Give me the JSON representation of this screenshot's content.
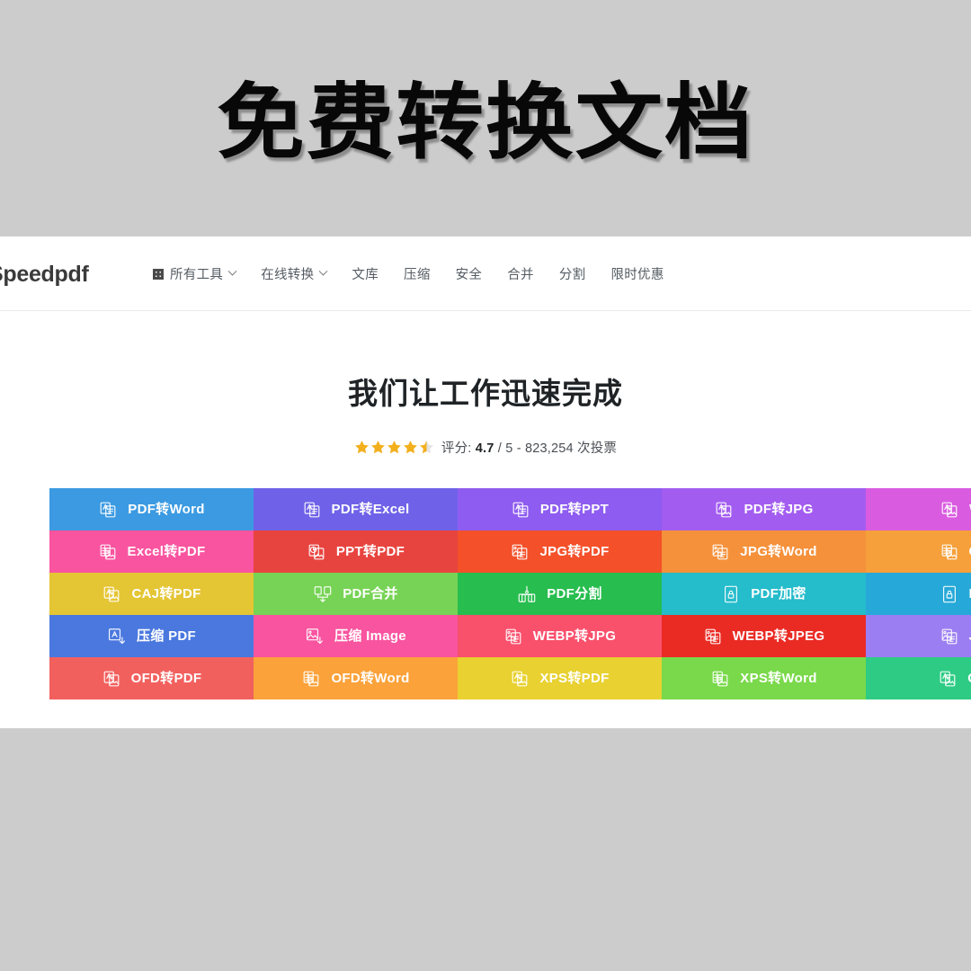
{
  "banner": {
    "title": "免费转换文档"
  },
  "navbar": {
    "brand": "Speedpdf",
    "items": [
      {
        "label": "所有工具",
        "icon": "grid-icon",
        "caret": true
      },
      {
        "label": "在线转换",
        "icon": null,
        "caret": true
      },
      {
        "label": "文库",
        "icon": null,
        "caret": false
      },
      {
        "label": "压缩",
        "icon": null,
        "caret": false
      },
      {
        "label": "安全",
        "icon": null,
        "caret": false
      },
      {
        "label": "合并",
        "icon": null,
        "caret": false
      },
      {
        "label": "分割",
        "icon": null,
        "caret": false
      },
      {
        "label": "限时优惠",
        "icon": null,
        "caret": false
      }
    ]
  },
  "hero": {
    "title": "我们让工作迅速完成",
    "rating": {
      "stars_filled": 4,
      "stars_half": 1,
      "stars_total": 5,
      "star_color": "#f2b01e",
      "prefix": "评分: ",
      "score": "4.7",
      "suffix": " / 5 - 823,254 次投票"
    }
  },
  "tools": {
    "columns": 5,
    "rows": 5,
    "tiles": [
      {
        "label": "PDF转Word",
        "color": "#3b9ae1",
        "icon": "doc-translate-icon"
      },
      {
        "label": "PDF转Excel",
        "color": "#6f62e8",
        "icon": "doc-translate-icon"
      },
      {
        "label": "PDF转PPT",
        "color": "#8e5cf0",
        "icon": "doc-translate-icon"
      },
      {
        "label": "PDF转JPG",
        "color": "#a35cf0",
        "icon": "doc-image-icon"
      },
      {
        "label": "Wor",
        "color": "#d95be0",
        "icon": "doc-image-icon"
      },
      {
        "label": "Excel转PDF",
        "color": "#f9549f",
        "icon": "sheet-doc-icon"
      },
      {
        "label": "PPT转PDF",
        "color": "#e8443f",
        "icon": "slide-doc-icon"
      },
      {
        "label": "JPG转PDF",
        "color": "#f4502a",
        "icon": "image-doc-icon"
      },
      {
        "label": "JPG转Word",
        "color": "#f5913a",
        "icon": "image-doc-icon"
      },
      {
        "label": "CAJ",
        "color": "#f5a03a",
        "icon": "sheet-doc-icon"
      },
      {
        "label": "CAJ转PDF",
        "color": "#e4c534",
        "icon": "doc-image-icon"
      },
      {
        "label": "PDF合并",
        "color": "#77d355",
        "icon": "merge-icon"
      },
      {
        "label": "PDF分割",
        "color": "#27bd4f",
        "icon": "split-icon"
      },
      {
        "label": "PDF加密",
        "color": "#25bccb",
        "icon": "lock-doc-icon"
      },
      {
        "label": "PDF",
        "color": "#26a9d8",
        "icon": "lock-doc-icon"
      },
      {
        "label": "压缩 PDF",
        "color": "#4a78df",
        "icon": "compress-doc-icon"
      },
      {
        "label": "压缩 Image",
        "color": "#f9549f",
        "icon": "compress-image-icon"
      },
      {
        "label": "WEBP转JPG",
        "color": "#f9506c",
        "icon": "image-doc-icon"
      },
      {
        "label": "WEBP转JPEG",
        "color": "#ea2b24",
        "icon": "image-doc-icon"
      },
      {
        "label": "JPG",
        "color": "#9b7ef2",
        "icon": "image-doc-icon"
      },
      {
        "label": "OFD转PDF",
        "color": "#f2605e",
        "icon": "doc-image-icon"
      },
      {
        "label": "OFD转Word",
        "color": "#fba23a",
        "icon": "sheet-doc-icon"
      },
      {
        "label": "XPS转PDF",
        "color": "#e8d130",
        "icon": "doc-image-icon"
      },
      {
        "label": "XPS转Word",
        "color": "#79d94a",
        "icon": "sheet-doc-icon"
      },
      {
        "label": "CAD",
        "color": "#2ecb84",
        "icon": "doc-image-icon"
      }
    ]
  },
  "colors": {
    "page_background": "#cccccc",
    "card_background": "#ffffff",
    "nav_text": "#555c63",
    "heading_text": "#1f2326"
  }
}
